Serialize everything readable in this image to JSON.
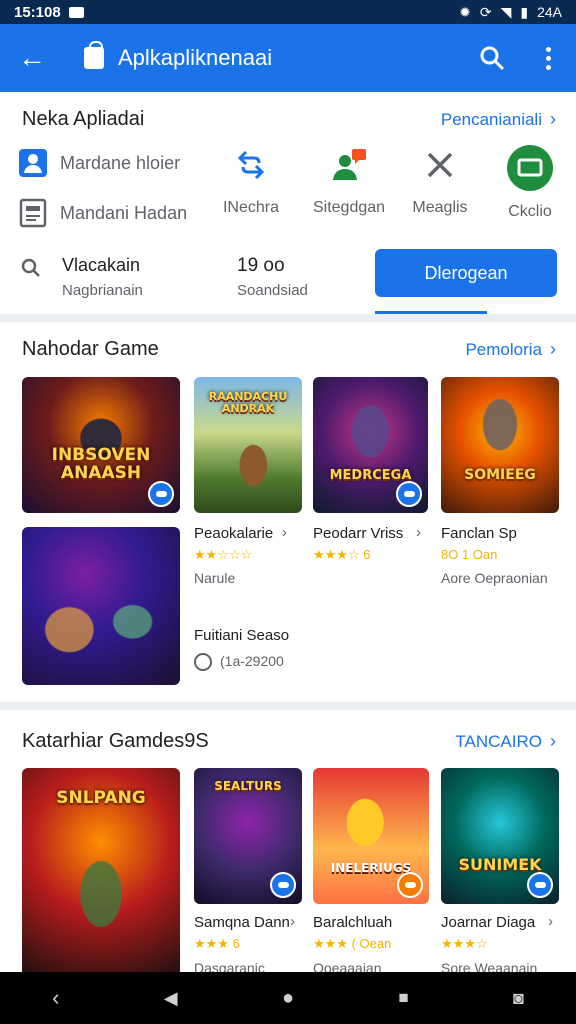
{
  "status_bar": {
    "time": "15:108",
    "right_text": "24A"
  },
  "app_bar": {
    "title": "Aplkapliknenaai"
  },
  "card1": {
    "title": "Neka Apliadai",
    "link": "Pencanianiali",
    "quick": [
      {
        "label": "Mardane hloier",
        "icon": "person-icon"
      },
      {
        "label": "Mandani Hadan",
        "icon": "document-icon"
      }
    ],
    "tools": [
      {
        "label": "INechra",
        "icon": "swap-arrows-icon"
      },
      {
        "label": "Sitegdgan",
        "icon": "user-chat-icon"
      },
      {
        "label": "Meaglis",
        "icon": "close-icon"
      },
      {
        "label": "Ckclio",
        "icon": "screen-icon"
      }
    ],
    "search": {
      "title": "Vlacakain",
      "subtitle": "Nagbrianain"
    },
    "stat": {
      "value": "19 oo",
      "label": "Soandsiad"
    },
    "button": "Dlerogean"
  },
  "card2": {
    "title": "Nahodar Game",
    "link": "Pemoloria",
    "games": [
      {
        "caption": "INBSOVEN ANAASH"
      },
      {
        "caption": "RAANDACHU ANDRAK",
        "name": "Peaokalarie",
        "stars": "★★☆☆☆",
        "sub": "Narule"
      },
      {
        "caption": "MEDRCEGA",
        "name": "Peodarr Vriss",
        "stars": "★★★☆ 6",
        "sub": ""
      },
      {
        "caption": "SOMIEEG",
        "name": "Fanclan Sp",
        "stars": "8O 1 Oan",
        "sub": "Aore Oepraonian"
      }
    ],
    "featured": {
      "name": "Fuitiani Seaso",
      "meta": "(1a-29200"
    }
  },
  "card3": {
    "title": "Katarhiar Gamdes9S",
    "link": "TANCAIRO",
    "games": [
      {
        "caption": "SNLPANG"
      },
      {
        "caption": "SEALTURS",
        "name": "Samqna Dann",
        "stars": "★★★ 6",
        "sub": "Dasgaranic"
      },
      {
        "caption": "INELERIUGS",
        "name": "Baralchluah",
        "stars": "★★★ ( Oean",
        "sub": "Ooeaaaian"
      },
      {
        "caption": "SUNIMEK",
        "name": "Joarnar Diaga",
        "stars": "★★★☆",
        "sub": "Sore Weaanain"
      }
    ]
  },
  "colors": {
    "accent": "#1a73e8",
    "statusbar": "#0b2a52",
    "stars": "#f4b400",
    "green": "#1e8e3e"
  }
}
